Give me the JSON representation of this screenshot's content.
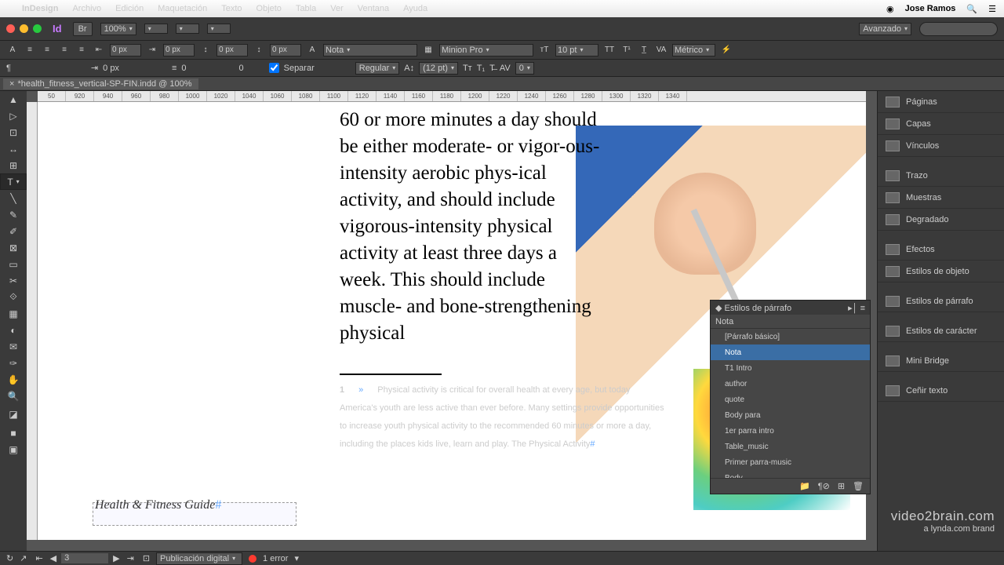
{
  "menubar": {
    "app": "InDesign",
    "items": [
      "Archivo",
      "Edición",
      "Maquetación",
      "Texto",
      "Objeto",
      "Tabla",
      "Ver",
      "Ventana",
      "Ayuda"
    ],
    "user": "Jose Ramos"
  },
  "toolbar": {
    "zoom": "100%",
    "workspace": "Avanzado"
  },
  "control": {
    "px1": "0 px",
    "px2": "0 px",
    "px3": "0 px",
    "px4": "0 px",
    "px5": "0 px",
    "px6": "0",
    "styledd": "Nota",
    "font": "Minion Pro",
    "fontsize": "10 pt",
    "fontstyle": "Regular",
    "leading": "(12 pt)",
    "kerning": "Métrico",
    "tracking": "0",
    "separar": "Separar"
  },
  "tab": {
    "name": "*health_fitness_vertical-SP-FIN.indd @ 100%"
  },
  "ruler": [
    "50",
    "920",
    "940",
    "960",
    "980",
    "1000",
    "1020",
    "1040",
    "1060",
    "1080",
    "1100",
    "1120",
    "1140",
    "1160",
    "1180",
    "1200",
    "1220",
    "1240",
    "1260",
    "1280",
    "1300",
    "1320",
    "1340"
  ],
  "page": {
    "body": "60 or more minutes a day should be either moderate- or vigor-ous-intensity aerobic phys-ical activity, and should include vigorous-intensity physical activity at least three days a week. This should include muscle- and bone-strengthening physical",
    "footnum": "1",
    "footarrow": "»",
    "foot": "Physical activity is critical for overall health at every age, but today America's youth are less active than ever before. Many settings provide opportunities to increase youth physical activity to the recommended 60 minutes or more a day, including the places kids live, learn and play. The Physical Activity",
    "footer": "Health & Fitness Guide"
  },
  "panels": [
    "Páginas",
    "Capas",
    "Vínculos",
    "Trazo",
    "Muestras",
    "Degradado",
    "Efectos",
    "Estilos de objeto",
    "Estilos de párrafo",
    "Estilos de carácter",
    "Mini Bridge",
    "Ceñir texto"
  ],
  "parapanel": {
    "title": "Estilos de párrafo",
    "current": "Nota",
    "items": [
      "[Párrafo básico]",
      "Nota",
      "T1 Intro",
      "author",
      "quote",
      "Body para",
      "1er parra intro",
      "Table_music",
      "Primer parra-music",
      "Body"
    ],
    "active": 1
  },
  "status": {
    "page": "3",
    "preset": "Publicación digital",
    "errors": "1 error"
  },
  "watermark": {
    "main": "video2brain.com",
    "sub": "a lynda.com brand"
  }
}
